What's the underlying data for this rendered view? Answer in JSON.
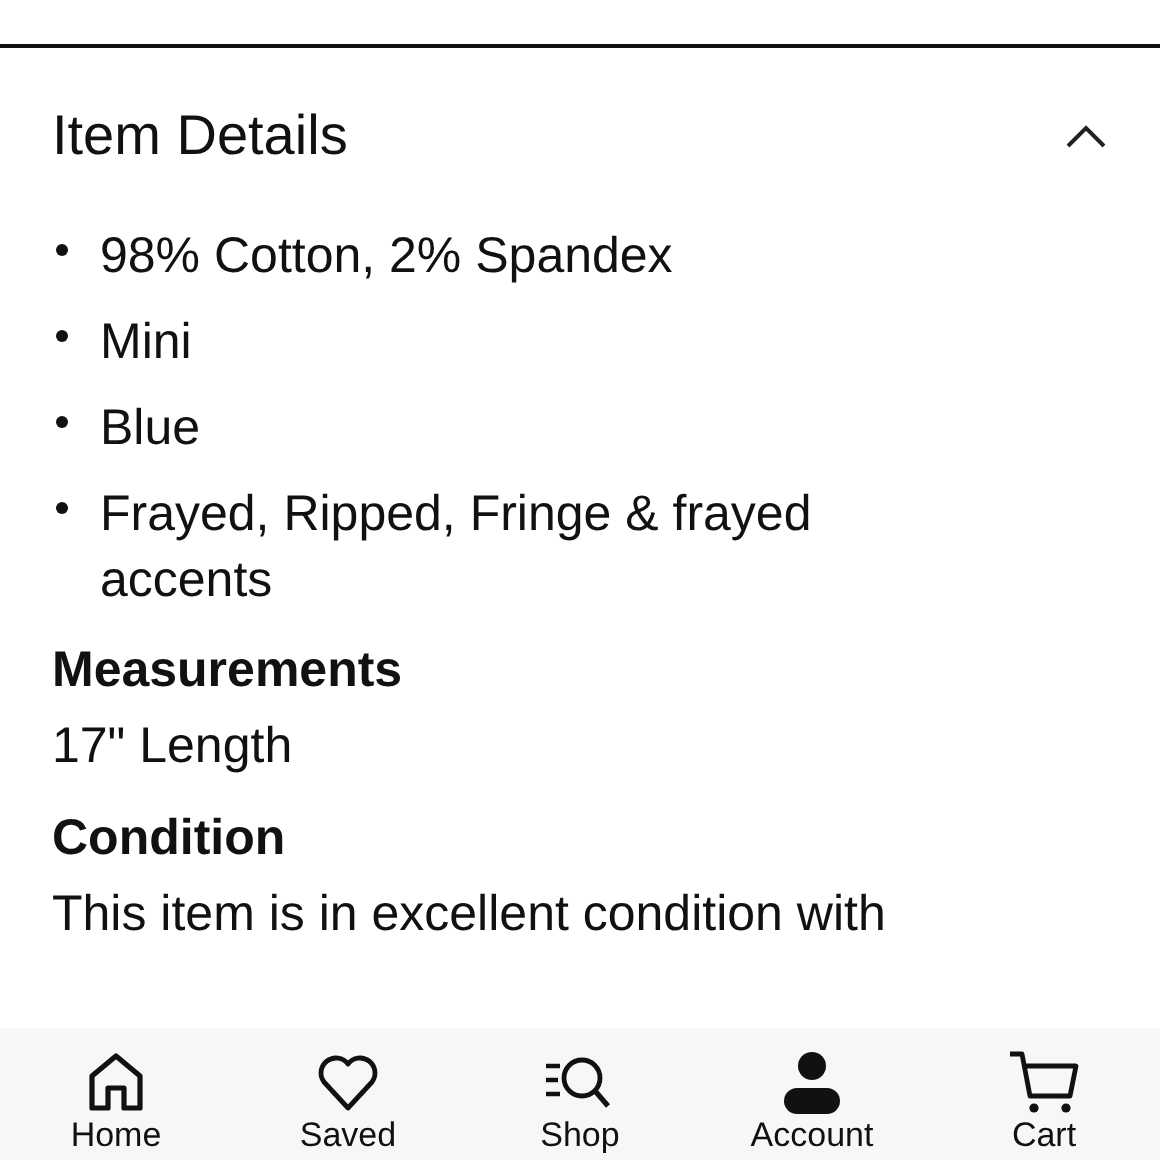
{
  "section": {
    "title": "Item Details",
    "expanded": true
  },
  "bullets": [
    "98% Cotton, 2% Spandex",
    "Mini",
    "Blue",
    "Frayed, Ripped, Fringe & frayed accents"
  ],
  "details": [
    {
      "heading": "Measurements",
      "text": "17\" Length"
    },
    {
      "heading": "Condition",
      "text": "This item is in excellent condition with"
    }
  ],
  "tab_bar": [
    {
      "label": "Home",
      "kind": "home"
    },
    {
      "label": "Saved",
      "kind": "saved"
    },
    {
      "label": "Shop",
      "kind": "shop"
    },
    {
      "label": "Account",
      "kind": "account"
    },
    {
      "label": "Cart",
      "kind": "cart"
    }
  ]
}
